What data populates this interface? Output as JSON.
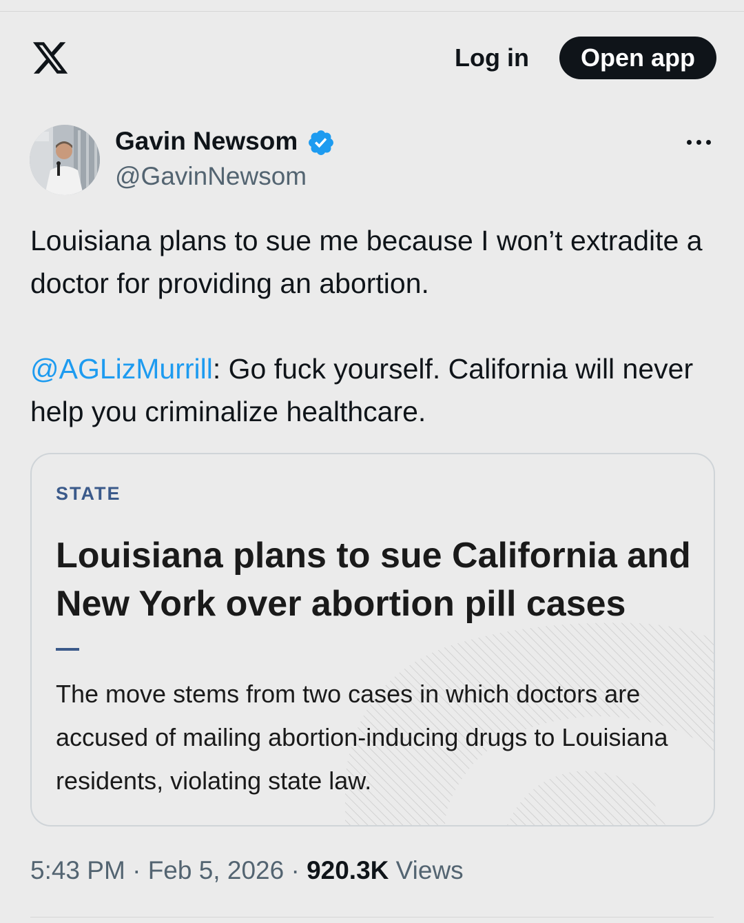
{
  "header": {
    "login_label": "Log in",
    "open_app_label": "Open app"
  },
  "author": {
    "name": "Gavin Newsom",
    "handle": "@GavinNewsom",
    "verified": true
  },
  "tweet": {
    "paragraph1": "Louisiana plans to sue me because I won’t extradite a doctor for providing an abortion.",
    "mention": "@AGLizMurrill",
    "paragraph2_rest": ": Go fuck yourself. California will never help you criminalize healthcare."
  },
  "card": {
    "section": "STATE",
    "headline": "Louisiana plans to sue California and New York over abortion pill cases",
    "description": "The move stems from two cases in which doctors are accused of mailing abortion-inducing drugs to Louisiana residents, violating state law."
  },
  "meta": {
    "time": "5:43 PM",
    "separator": "·",
    "date": "Feb 5, 2026",
    "views_count": "920.3K",
    "views_label": "Views"
  },
  "colors": {
    "background": "#ebebeb",
    "text": "#0f1419",
    "secondary_text": "#536471",
    "link": "#1d9bf0",
    "verified_badge": "#1d9bf0",
    "card_section": "#3b5a8a"
  }
}
